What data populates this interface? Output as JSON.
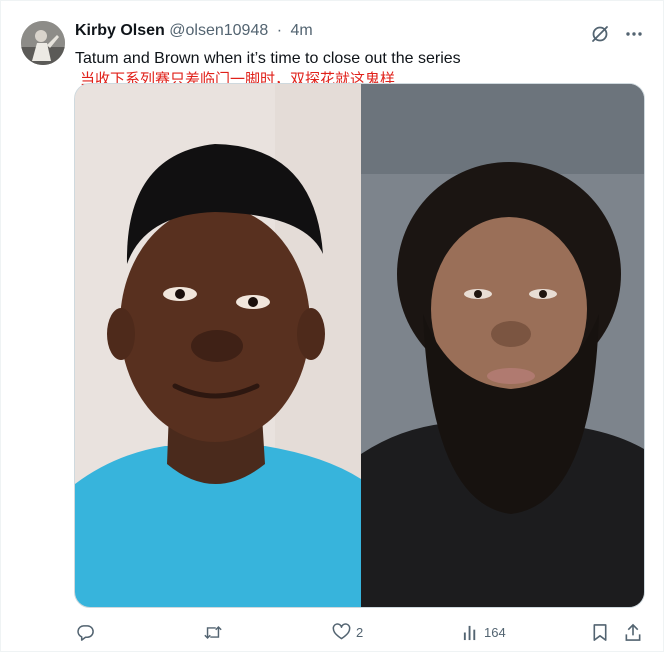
{
  "tweet": {
    "author_name": "Kirby Olsen",
    "handle": "@olsen10948",
    "separator": "·",
    "time": "4m",
    "text": "Tatum and Brown when it’s time to close out the series",
    "translation": "当收下系列赛只差临门一脚时，双探花就这鬼样"
  },
  "media": {
    "left_image": "photo-young-man-blue-shirt",
    "right_image": "photo-bearded-man-dark-cape"
  },
  "actions": {
    "reply_count": "",
    "retweet_count": "",
    "like_count": "2",
    "views_count": "164"
  },
  "colors": {
    "text": "#0f1419",
    "muted": "#536471",
    "translation": "#e0211a",
    "border": "#cfd9de"
  },
  "icons": [
    "avatar",
    "grok-icon",
    "more-icon",
    "reply-icon",
    "retweet-icon",
    "like-icon",
    "views-icon",
    "bookmark-icon",
    "share-icon"
  ]
}
